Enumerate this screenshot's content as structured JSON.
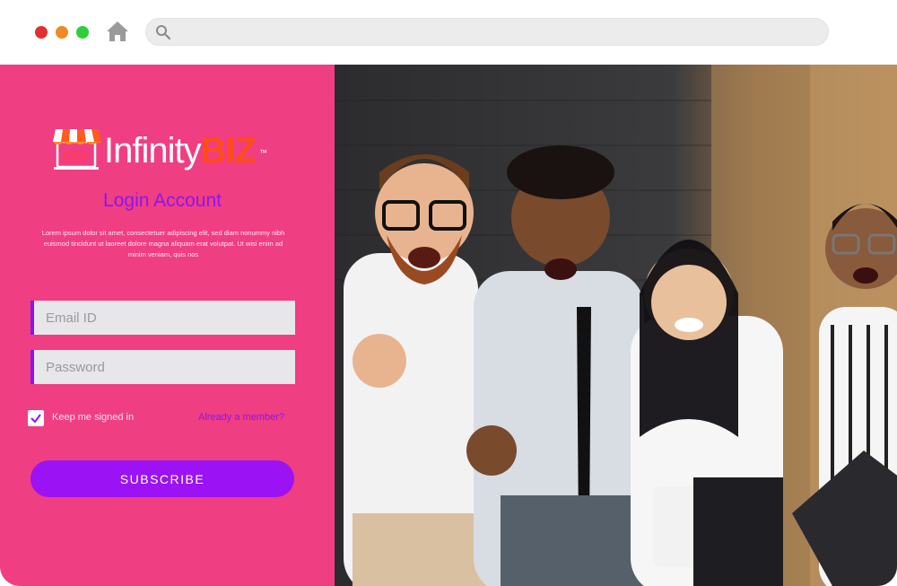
{
  "browser": {
    "traffic_lights": {
      "close": "#e0312f",
      "minimize": "#f08a23",
      "maximize": "#2fcf3b"
    },
    "home_icon": "home-icon",
    "search_icon": "search-icon",
    "url": ""
  },
  "brand": {
    "name_part1": "Infinity",
    "name_part2": "BIZ",
    "trademark": "™",
    "accent": "#8a16f2",
    "panel_color": "#ef3e82"
  },
  "login": {
    "title": "Login Account",
    "description": "Lorem ipsum dolor sit amet, consectetuer adipiscing elit, sed diam nonummy nibh euismod tincidunt ut laoreet dolore magna aliquam erat volutpat. Ut wisi enim ad minim veniam, quis nos",
    "email_placeholder": "Email ID",
    "password_placeholder": "Password",
    "keep_signed_in_label": "Keep me signed in",
    "keep_signed_in_checked": true,
    "member_link": "Already a member?",
    "submit_label": "SUBSCRIBE"
  }
}
